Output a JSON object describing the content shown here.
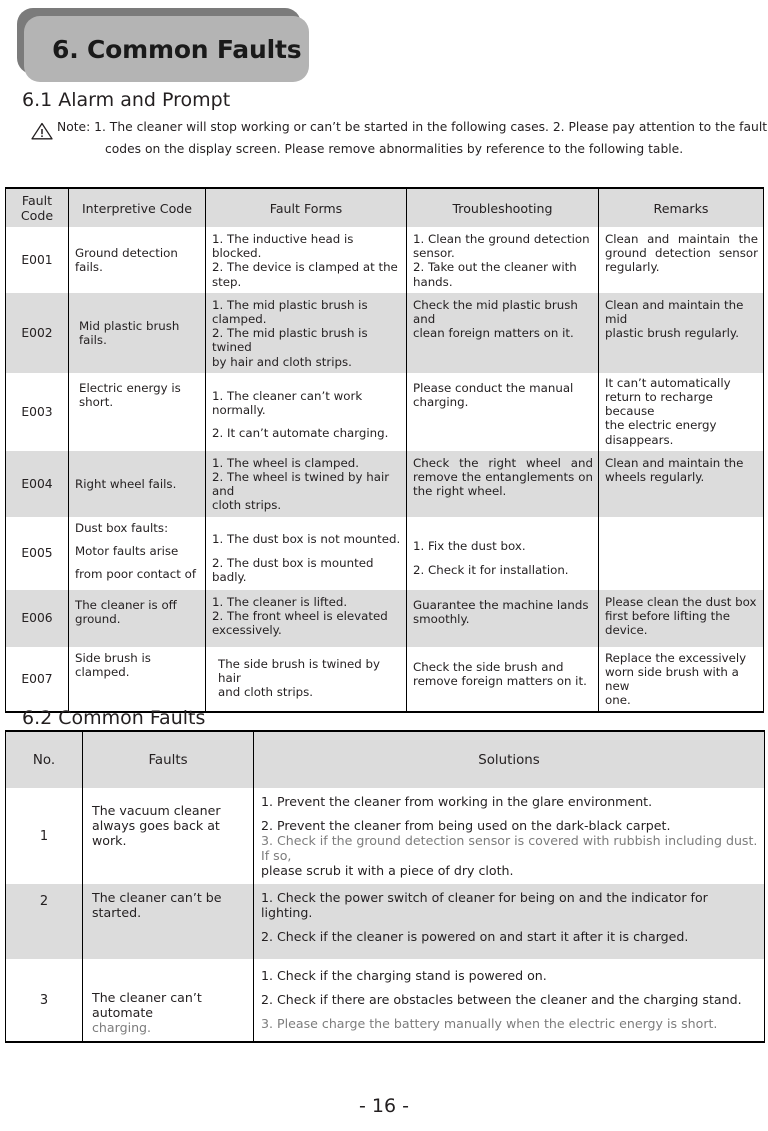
{
  "chapter": {
    "title": "6. Common Faults",
    "banner_fill": "#b4b4b4",
    "banner_shadow": "#7b7b7b"
  },
  "sections": {
    "alarm_heading": "6.1 Alarm and Prompt",
    "common_heading": "6.2 Common Faults"
  },
  "note": {
    "icon": "warning-triangle-icon",
    "line1": "Note: 1. The cleaner will stop working or can’t be started in the following cases. 2. Please pay attention to the fault",
    "line2": "codes on the display screen. Please remove abnormalities by reference to the following table."
  },
  "alarm_table": {
    "headers": [
      "Fault Code",
      "Interpretive Code",
      "Fault Forms",
      "Troubleshooting",
      "Remarks"
    ],
    "rows": [
      {
        "code": "E001",
        "interpretive": [
          "Ground detection fails."
        ],
        "forms": [
          "1. The inductive head is blocked.",
          "2. The device is clamped at the",
          "step."
        ],
        "troubleshooting": [
          "1. Clean the ground detection",
          "sensor.",
          "2. Take out the cleaner with",
          "hands."
        ],
        "remarks": [
          "Clean and maintain the ground detection sensor regularly."
        ]
      },
      {
        "code": "E002",
        "interpretive": [
          "Mid plastic brush fails."
        ],
        "forms": [
          "1. The mid plastic brush is",
          "clamped.",
          "2. The mid plastic brush is twined",
          "by hair and cloth strips."
        ],
        "troubleshooting": [
          "Check the mid plastic brush and",
          "clean foreign matters on it."
        ],
        "remarks": [
          "Clean and maintain the mid",
          "plastic brush regularly."
        ]
      },
      {
        "code": "E003",
        "interpretive": [
          "Electric energy  is short."
        ],
        "forms": [
          "1. The cleaner can’t work normally.",
          "2. It can’t automate charging."
        ],
        "troubleshooting": [
          "Please conduct the manual",
          "charging."
        ],
        "remarks": [
          "It can’t automatically",
          "return to recharge because",
          "the electric energy",
          "disappears."
        ]
      },
      {
        "code": "E004",
        "interpretive": [
          "Right wheel fails."
        ],
        "forms": [
          "1. The wheel is clamped.",
          "2. The wheel is twined by hair and",
          "cloth strips."
        ],
        "troubleshooting": [
          "Check the right wheel and remove the entanglements on the right wheel."
        ],
        "remarks": [
          "Clean and maintain the",
          "wheels regularly."
        ]
      },
      {
        "code": "E005",
        "interpretive": [
          "Dust box faults:",
          "Motor faults arise",
          "from poor contact of"
        ],
        "forms": [
          "1. The dust box is not mounted.",
          "2. The dust box is mounted badly."
        ],
        "troubleshooting": [
          "1. Fix the dust box.",
          "2. Check it for installation."
        ],
        "remarks": [
          ""
        ]
      },
      {
        "code": "E006",
        "interpretive": [
          "The cleaner is off",
          "ground."
        ],
        "forms": [
          "1. The cleaner is lifted.",
          "2. The front wheel is elevated",
          "excessively."
        ],
        "troubleshooting": [
          "Guarantee the machine lands",
          "smoothly."
        ],
        "remarks": [
          "Please clean the dust box",
          "first before lifting the",
          "device."
        ]
      },
      {
        "code": "E007",
        "interpretive": [
          "Side brush is clamped."
        ],
        "forms": [
          "The side brush is twined by hair",
          "and cloth strips."
        ],
        "troubleshooting": [
          "Check the side brush and",
          "remove foreign matters on it."
        ],
        "remarks": [
          "Replace the excessively",
          "worn side brush with a new",
          "one."
        ]
      }
    ]
  },
  "common_table": {
    "headers": [
      "No.",
      "Faults",
      "Solutions"
    ],
    "rows": [
      {
        "no": "1",
        "fault": [
          "The vacuum cleaner",
          "always goes back at",
          "work."
        ],
        "solutions": [
          "1. Prevent the cleaner from working in the glare environment.",
          "2. Prevent the cleaner from being used on the dark-black carpet.",
          "3. Check if the ground detection sensor is covered with rubbish including dust. If so,",
          "please scrub it with a piece of dry cloth."
        ]
      },
      {
        "no": "2",
        "fault": [
          "The cleaner can’t be",
          "started."
        ],
        "solutions": [
          "1. Check the power switch of cleaner for being on and the indicator for lighting.",
          "2. Check if the cleaner is powered on and start it after it is charged."
        ]
      },
      {
        "no": "3",
        "fault": [
          "The cleaner can’t automate",
          "charging."
        ],
        "solutions": [
          "1. Check if the charging stand is powered on.",
          "2. Check if there are obstacles between the cleaner and the charging stand.",
          "3. Please charge the battery manually when the electric energy is short."
        ]
      }
    ]
  },
  "footer": {
    "page_number": "- 16 -"
  }
}
